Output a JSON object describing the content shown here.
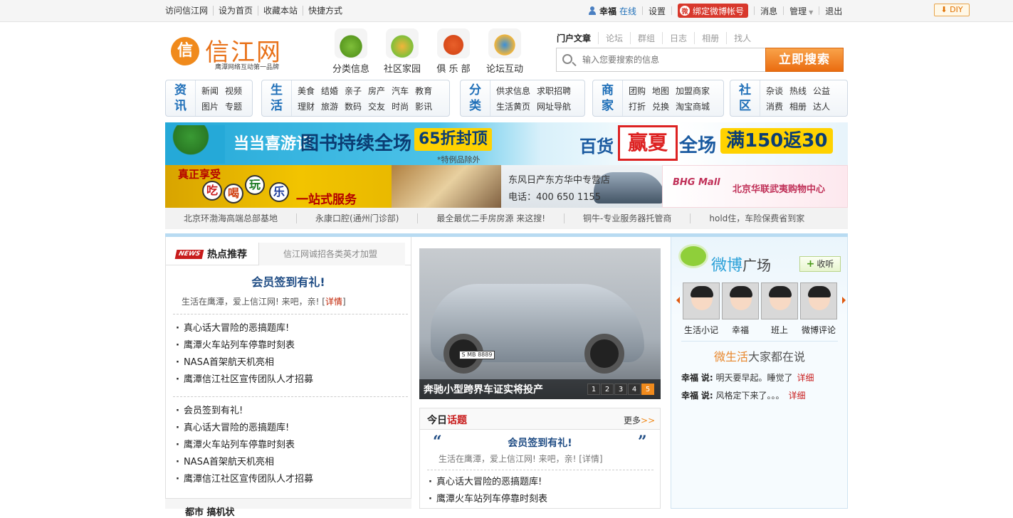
{
  "topbar": {
    "left_links": [
      "访问信江网",
      "设为首页",
      "收藏本站",
      "快捷方式"
    ],
    "user_name": "幸福",
    "online": "在线",
    "settings": "设置",
    "weibo_bind": "绑定微博帐号",
    "messages": "消息",
    "manage": "管理",
    "logout": "退出",
    "diy": "DIY"
  },
  "logo": {
    "circle": "信",
    "name": "信江网",
    "slogan": "鹰潭网络互动第一品牌"
  },
  "quick": [
    {
      "label": "分类信息",
      "color": "#7fbf3a"
    },
    {
      "label": "社区家园",
      "color": "#f2b53a"
    },
    {
      "label": "俱 乐 部",
      "color": "#e8602a"
    },
    {
      "label": "论坛互动",
      "color": "#3a8fd8"
    }
  ],
  "search": {
    "tabs": [
      "门户文章",
      "论坛",
      "群组",
      "日志",
      "相册",
      "找人"
    ],
    "placeholder": "输入您要搜索的信息",
    "button": "立即搜索"
  },
  "nav": [
    {
      "title": [
        "资",
        "讯"
      ],
      "links": [
        "新闻",
        "视频",
        "图片",
        "专题"
      ],
      "cols": 2
    },
    {
      "title": [
        "生",
        "活"
      ],
      "links": [
        "美食",
        "结婚",
        "亲子",
        "房产",
        "汽车",
        "教育",
        "理财",
        "旅游",
        "数码",
        "交友",
        "时尚",
        "影讯"
      ],
      "cols": 6
    },
    {
      "title": [
        "分",
        "类"
      ],
      "links": [
        "供求信息",
        "求职招聘",
        "生活黄页",
        "网址导航"
      ],
      "cols": 2
    },
    {
      "title": [
        "商",
        "家"
      ],
      "links": [
        "团购",
        "地图",
        "加盟商家",
        "打折",
        "兑换",
        "淘宝商城"
      ],
      "cols": 3
    },
    {
      "title": [
        "社",
        "区"
      ],
      "links": [
        "杂谈",
        "热线",
        "公益",
        "消费",
        "相册",
        "达人"
      ],
      "cols": 3
    }
  ],
  "banner1": {
    "brand": "当当喜游记",
    "headline": "图书持续全场",
    "deal": "65折封顶",
    "note": "*特例品除外",
    "right_a": "百货",
    "right_b": "赢夏",
    "right_c": "全场",
    "right_deal": "满150返30"
  },
  "banner2": {
    "top": "真正享受",
    "chars": [
      "吃",
      "喝",
      "玩",
      "乐"
    ],
    "service": "一站式服务"
  },
  "banner3": {
    "line1": "东风日产东方华中专营店",
    "line2": "电话：400 650 1155"
  },
  "banner4": {
    "logo": "BHG Mall",
    "text": "北京华联武夷购物中心"
  },
  "text_ads": [
    "北京环渤海高端总部基地",
    "永康口腔(通州门诊部)",
    "最全最优二手房房源 来这搜!",
    "铜牛-专业服务器托管商",
    "hold住，车险保费省到家"
  ],
  "hot": {
    "badge": "NEWS",
    "tab_active": "热点推荐",
    "tab_other": "信江网诚招各类英才加盟",
    "headline": "会员签到有礼!",
    "sub": "生活在鹰潭，爱上信江网! 来吧，亲!",
    "sub_link": "详情",
    "list1": [
      "真心话大冒险的恶搞题库!",
      "鹰潭火车站列车停靠时刻表",
      "NASA首架航天机亮相",
      "鹰潭信江社区宣传团队人才招募"
    ],
    "list2": [
      "会员签到有礼!",
      "真心话大冒险的恶搞题库!",
      "鹰潭火车站列车停靠时刻表",
      "NASA首架航天机亮相",
      "鹰潭信江社区宣传团队人才招募"
    ],
    "bottom_title": "都市 搞机状"
  },
  "slide": {
    "caption": "奔驰小型跨界车证实将投产",
    "plate": "S MB 8889",
    "pages": [
      "1",
      "2",
      "3",
      "4",
      "5"
    ],
    "active_page": 5
  },
  "topic": {
    "title_a": "今日",
    "title_b": "话题",
    "more": "更多",
    "more_arrow": ">>",
    "headline": "会员签到有礼!",
    "sub": "生活在鹰潭，爱上信江网! 来吧，亲! [详情]",
    "list": [
      "真心话大冒险的恶搞题库!",
      "鹰潭火车站列车停靠时刻表"
    ]
  },
  "weibo": {
    "title_a": "微博",
    "title_b": "广场",
    "follow_plus": "+",
    "follow": "收听",
    "users": [
      "生活小记",
      "幸福",
      "班上",
      "微博评论"
    ],
    "life_a": "微生活",
    "life_b": "大家都在说",
    "posts": [
      {
        "user": "幸福",
        "says": "说:",
        "text": "明天要早起。睡觉了",
        "link": "详细"
      },
      {
        "user": "幸福",
        "says": "说:",
        "text": "风格定下来了。。。",
        "link": "详细"
      }
    ]
  }
}
